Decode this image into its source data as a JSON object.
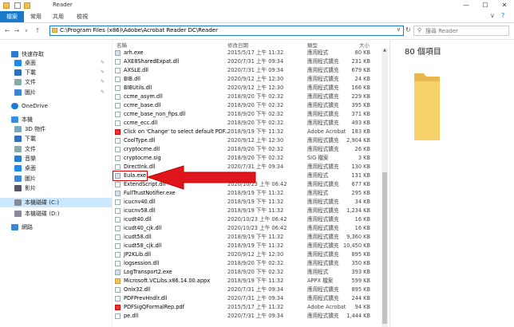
{
  "window": {
    "title": "Reader",
    "minimize": "—",
    "maximize": "☐",
    "close": "✕"
  },
  "ribbon": {
    "tabs": [
      "檔案",
      "常用",
      "共用",
      "檢視"
    ],
    "active_tab": 0,
    "expand_glyph": "∨",
    "help_glyph": "?"
  },
  "addressbar": {
    "back": "←",
    "forward": "→",
    "recent": "∨",
    "up": "↑",
    "path": "C:\\Program Files (x86)\\Adobe\\Acrobat Reader DC\\Reader",
    "dropdown": "∨",
    "refresh": "↻",
    "search_placeholder": "搜尋 Reader"
  },
  "sidebar": {
    "items": [
      {
        "label": "快速存取",
        "icon": "star-icon",
        "pinned": false
      },
      {
        "label": "桌面",
        "icon": "desktop-icon",
        "pinned": true
      },
      {
        "label": "下載",
        "icon": "download-icon",
        "pinned": true
      },
      {
        "label": "文件",
        "icon": "document-icon",
        "pinned": true
      },
      {
        "label": "圖片",
        "icon": "picture-icon",
        "pinned": true
      },
      {
        "label": "OneDrive",
        "icon": "cloud-icon",
        "pinned": false
      },
      {
        "label": "本機",
        "icon": "computer-icon",
        "pinned": false
      },
      {
        "label": "3D 物件",
        "icon": "cube-icon",
        "pinned": false
      },
      {
        "label": "下載",
        "icon": "download-icon",
        "pinned": false
      },
      {
        "label": "文件",
        "icon": "document-icon",
        "pinned": false
      },
      {
        "label": "音樂",
        "icon": "music-icon",
        "pinned": false
      },
      {
        "label": "桌面",
        "icon": "desktop-icon",
        "pinned": false
      },
      {
        "label": "圖片",
        "icon": "picture-icon",
        "pinned": false
      },
      {
        "label": "影片",
        "icon": "video-icon",
        "pinned": false
      },
      {
        "label": "本機磁碟 (C:)",
        "icon": "drive-icon",
        "pinned": false,
        "selected": true
      },
      {
        "label": "本機磁碟 (D:)",
        "icon": "drive-icon",
        "pinned": false
      },
      {
        "label": "網路",
        "icon": "network-icon",
        "pinned": false
      }
    ],
    "pin_glyph": "📌"
  },
  "columns": {
    "name": "名稱",
    "date": "修改日期",
    "type": "類型",
    "size": "大小"
  },
  "files": [
    {
      "name": "arh.exe",
      "date": "2015/5/17 上午 11:32",
      "type": "應用程式",
      "size": "80 KB",
      "kind": "exe"
    },
    {
      "name": "AXE8SharedExpat.dll",
      "date": "2020/7/31 上午 09:34",
      "type": "應用程式擴充",
      "size": "231 KB",
      "kind": "dll"
    },
    {
      "name": "AXSLE.dll",
      "date": "2020/7/31 上午 09:34",
      "type": "應用程式擴充",
      "size": "679 KB",
      "kind": "dll"
    },
    {
      "name": "BIB.dll",
      "date": "2020/9/12 上午 12:30",
      "type": "應用程式擴充",
      "size": "24 KB",
      "kind": "dll"
    },
    {
      "name": "BIBUtils.dll",
      "date": "2020/9/12 上午 12:30",
      "type": "應用程式擴充",
      "size": "166 KB",
      "kind": "dll"
    },
    {
      "name": "ccme_asym.dll",
      "date": "2018/9/20 下午 02:32",
      "type": "應用程式擴充",
      "size": "229 KB",
      "kind": "dll"
    },
    {
      "name": "ccme_base.dll",
      "date": "2018/9/20 下午 02:32",
      "type": "應用程式擴充",
      "size": "395 KB",
      "kind": "dll"
    },
    {
      "name": "ccme_base_non_fips.dll",
      "date": "2018/9/20 下午 02:32",
      "type": "應用程式擴充",
      "size": "371 KB",
      "kind": "dll"
    },
    {
      "name": "ccme_ecc.dll",
      "date": "2018/9/20 下午 02:32",
      "type": "應用程式擴充",
      "size": "493 KB",
      "kind": "dll"
    },
    {
      "name": "Click on 'Change' to select default PDF...",
      "date": "2018/9/19 下午 11:32",
      "type": "Adobe Acrobat",
      "size": "183 KB",
      "kind": "pdf"
    },
    {
      "name": "CoolType.dll",
      "date": "2020/9/12 上午 12:30",
      "type": "應用程式擴充",
      "size": "2,904 KB",
      "kind": "dll"
    },
    {
      "name": "cryptocme.dll",
      "date": "2018/9/20 下午 02:32",
      "type": "應用程式擴充",
      "size": "26 KB",
      "kind": "dll"
    },
    {
      "name": "cryptocme.sig",
      "date": "2018/9/20 下午 02:32",
      "type": "SIG 檔案",
      "size": "3 KB",
      "kind": "sig"
    },
    {
      "name": "DirectInk.dll",
      "date": "2020/7/31 上午 09:34",
      "type": "應用程式擴充",
      "size": "130 KB",
      "kind": "dll"
    },
    {
      "name": "Eula.exe",
      "date": "09:34",
      "type": "應用程式",
      "size": "131 KB",
      "kind": "exe",
      "highlighted": true
    },
    {
      "name": "ExtendScript.dll",
      "date": "2020/10/23 上午 06:42",
      "type": "應用程式擴充",
      "size": "677 KB",
      "kind": "dll"
    },
    {
      "name": "FullTrustNotifier.exe",
      "date": "2018/9/19 下午 11:32",
      "type": "應用程式",
      "size": "295 KB",
      "kind": "exe"
    },
    {
      "name": "icucnv40.dll",
      "date": "2018/9/19 下午 11:32",
      "type": "應用程式擴充",
      "size": "34 KB",
      "kind": "dll"
    },
    {
      "name": "icucnv58.dll",
      "date": "2018/9/19 下午 11:32",
      "type": "應用程式擴充",
      "size": "1,234 KB",
      "kind": "dll"
    },
    {
      "name": "icudt40.dll",
      "date": "2020/10/23 上午 06:42",
      "type": "應用程式擴充",
      "size": "16 KB",
      "kind": "dll"
    },
    {
      "name": "icudt40_cjk.dll",
      "date": "2020/10/23 上午 06:42",
      "type": "應用程式擴充",
      "size": "16 KB",
      "kind": "dll"
    },
    {
      "name": "icudt58.dll",
      "date": "2018/9/19 下午 11:32",
      "type": "應用程式擴充",
      "size": "9,360 KB",
      "kind": "dll"
    },
    {
      "name": "icudt58_cjk.dll",
      "date": "2018/9/19 下午 11:32",
      "type": "應用程式擴充",
      "size": "10,450 KB",
      "kind": "dll"
    },
    {
      "name": "JP2KLib.dll",
      "date": "2020/9/12 上午 12:30",
      "type": "應用程式擴充",
      "size": "895 KB",
      "kind": "dll"
    },
    {
      "name": "logsession.dll",
      "date": "2018/9/20 下午 02:32",
      "type": "應用程式擴充",
      "size": "350 KB",
      "kind": "dll"
    },
    {
      "name": "LogTransport2.exe",
      "date": "2018/9/20 下午 02:32",
      "type": "應用程式",
      "size": "393 KB",
      "kind": "exe"
    },
    {
      "name": "Microsoft.VCLibs.x86.14.00.appx",
      "date": "2018/9/19 下午 11:32",
      "type": "APPX 檔案",
      "size": "599 KB",
      "kind": "appx"
    },
    {
      "name": "Onix32.dll",
      "date": "2020/7/31 上午 09:34",
      "type": "應用程式擴充",
      "size": "895 KB",
      "kind": "dll"
    },
    {
      "name": "PDFPrevHndlr.dll",
      "date": "2020/7/31 上午 09:34",
      "type": "應用程式擴充",
      "size": "244 KB",
      "kind": "dll"
    },
    {
      "name": "PDFSigQFormalRep.pdf",
      "date": "2015/5/17 上午 11:32",
      "type": "Adobe Acrobat",
      "size": "94 KB",
      "kind": "pdf"
    },
    {
      "name": "pe.dll",
      "date": "2020/7/31 上午 09:34",
      "type": "應用程式擴充",
      "size": "1,444 KB",
      "kind": "dll"
    }
  ],
  "preview": {
    "count": "80 個項目"
  },
  "colors": {
    "accent": "#1979ca",
    "selection": "#cce8ff",
    "annotation_red": "#e0161d",
    "folder_yellow": "#f0c14b"
  }
}
